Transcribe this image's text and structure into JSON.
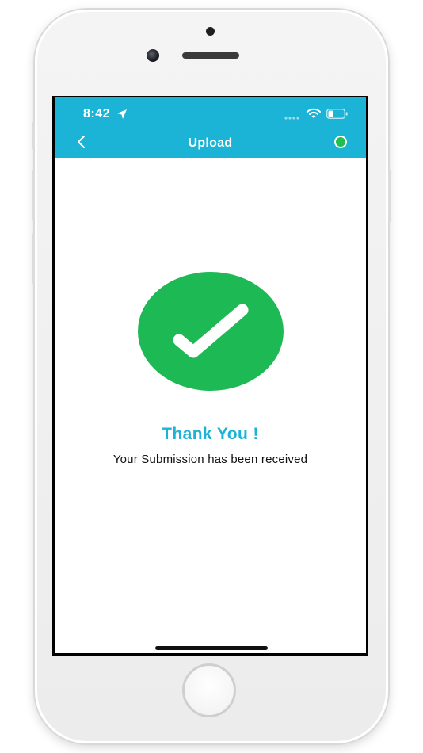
{
  "status_bar": {
    "time": "8:42"
  },
  "nav": {
    "title": "Upload",
    "back_icon": "chevron-left-icon",
    "status_indicator_color": "#1fbf4c"
  },
  "confirmation": {
    "icon": "checkmark-icon",
    "icon_color": "#1db954",
    "title": "Thank You !",
    "message": "Your Submission has been received"
  },
  "colors": {
    "header": "#1bb3d6",
    "accent_text": "#1bb3d6"
  }
}
